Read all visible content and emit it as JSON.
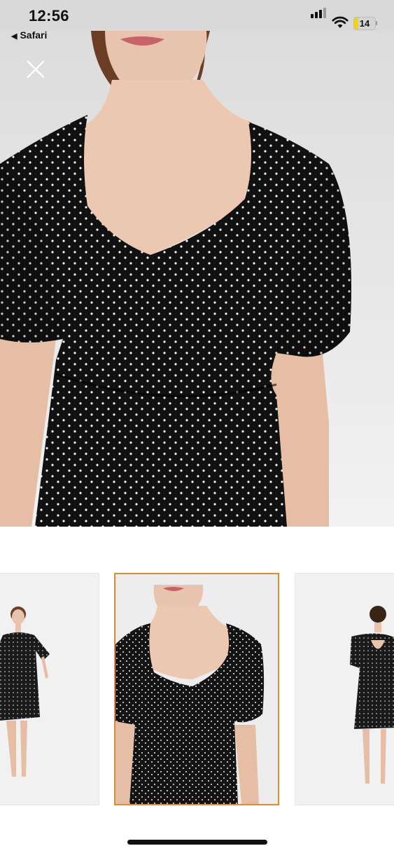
{
  "status_bar": {
    "time": "12:56",
    "back_app": "Safari",
    "battery_level": "14",
    "battery_color": "#f2d30f",
    "icons": [
      "signal-icon",
      "wifi-icon",
      "battery-icon"
    ]
  },
  "viewer": {
    "close_icon": "close-icon",
    "thumbnails": [
      {
        "name": "full-front-view",
        "selected": false
      },
      {
        "name": "closeup-front-view",
        "selected": true
      },
      {
        "name": "back-view",
        "selected": false
      }
    ],
    "selected_border_color": "#e08b2e"
  }
}
